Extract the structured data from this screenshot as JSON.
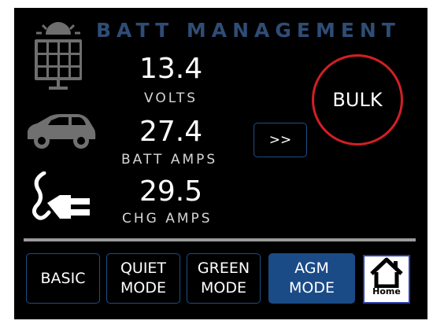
{
  "header": {
    "title": "BATT MANAGEMENT"
  },
  "readings": [
    {
      "value": "13.4",
      "unit": "VOLTS",
      "icon": "solar-panel-icon"
    },
    {
      "value": "27.4",
      "unit": "BATT AMPS",
      "icon": "car-icon"
    },
    {
      "value": "29.5",
      "unit": "CHG AMPS",
      "icon": "plug-icon"
    }
  ],
  "next_button": {
    "label": ">>"
  },
  "charge_state": {
    "label": "BULK",
    "ring_color": "#d21f26"
  },
  "modes": [
    {
      "line1": "BASIC",
      "line2": "",
      "active": false
    },
    {
      "line1": "QUIET",
      "line2": "MODE",
      "active": false
    },
    {
      "line1": "GREEN",
      "line2": "MODE",
      "active": false
    },
    {
      "line1": "AGM",
      "line2": "MODE",
      "active": true
    }
  ],
  "home_button": {
    "label": "Home",
    "icon": "home-icon"
  },
  "colors": {
    "background": "#000000",
    "title": "#2e4d76",
    "accent": "#1b4b87",
    "divider": "#9a9a9a"
  }
}
